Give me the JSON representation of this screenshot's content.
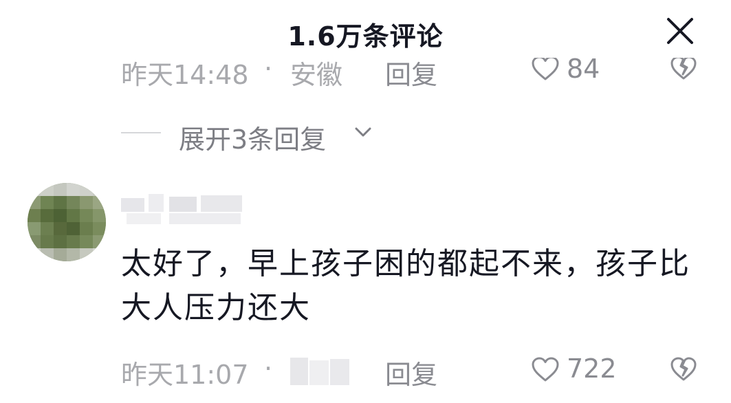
{
  "header": {
    "title": "1.6万条评论",
    "close_icon": "close-icon"
  },
  "previous_comment": {
    "time": "昨天14:48",
    "separator": "·",
    "location": "安徽",
    "reply_label": "回复",
    "like_count": "84"
  },
  "expand_replies": {
    "label": "展开3条回复"
  },
  "comment": {
    "text": "太好了，早上孩子困的都起不来，孩子比大人压力还大",
    "time": "昨天11:07",
    "separator": "·",
    "reply_label": "回复",
    "like_count": "722"
  },
  "colors": {
    "text_primary": "#161823",
    "text_secondary": "#a8a9ad",
    "action_gray": "#8a8b91",
    "background": "#ffffff"
  }
}
